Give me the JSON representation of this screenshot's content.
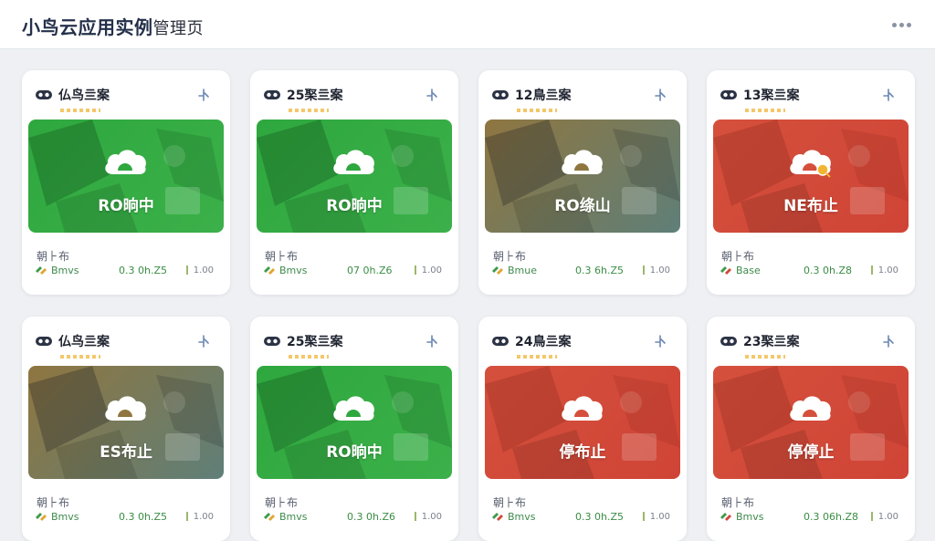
{
  "app": {
    "title": "小鸟云应用实例",
    "title_suffix": "管理页"
  },
  "colors": {
    "running": "#2f9c3f",
    "paused": "#7a6a44",
    "stopped": "#d1483a"
  },
  "cards": [
    {
      "name": "仏鸟亖案",
      "status": "RO晌中",
      "state": "running",
      "meta_label": "朝⺊布",
      "tag": "Bmvs",
      "metric": "0.3 0h.Z5",
      "value": "1.00",
      "tag_icon": "tag-icon"
    },
    {
      "name": "25棸亖案",
      "status": "RO晌中",
      "state": "running",
      "meta_label": "朝⺊布",
      "tag": "Bmvs",
      "metric": "07 0h.Z6",
      "value": "1.00",
      "tag_icon": "tag-icon"
    },
    {
      "name": "12鳥亖案",
      "status": "RO绦山",
      "state": "paused",
      "meta_label": "朝⺊布",
      "tag": "Bmue",
      "metric": "0.3 6h.Z5",
      "value": "1.00",
      "tag_icon": "tag-icon"
    },
    {
      "name": "13棸亖案",
      "status": "NE布止",
      "state": "stopped",
      "meta_label": "朝⺊布",
      "tag": "Base",
      "metric": "0.3 0h.Z8",
      "value": "1.00",
      "tag_icon": "tag-icon",
      "alert": true
    },
    {
      "name": "仏鸟亖案",
      "status": "ES布止",
      "state": "paused",
      "meta_label": "朝⺊布",
      "tag": "Bmvs",
      "metric": "0.3 0h.Z5",
      "value": "1.00",
      "tag_icon": "tag-icon"
    },
    {
      "name": "25棸亖案",
      "status": "RO晌中",
      "state": "running",
      "meta_label": "朝⺊布",
      "tag": "Bmvs",
      "metric": "0.3 0h.Z6",
      "value": "1.00",
      "tag_icon": "tag-icon"
    },
    {
      "name": "24鳥亖案",
      "status": "停布止",
      "state": "stopped",
      "meta_label": "朝⺊布",
      "tag": "Bmvs",
      "metric": "0.3 0h.Z5",
      "value": "1.00",
      "tag_icon": "tag-icon"
    },
    {
      "name": "23棸亖案",
      "status": "停停止",
      "state": "stopped",
      "meta_label": "朝⺊布",
      "tag": "Bmvs",
      "metric": "0.3 06h.Z8",
      "value": "1.00",
      "tag_icon": "tag-icon"
    }
  ],
  "icons": {
    "instance": "vr-headset-icon",
    "pin": "pin-icon",
    "cloud": "cloud-icon",
    "more": "more-horizontal-icon"
  }
}
